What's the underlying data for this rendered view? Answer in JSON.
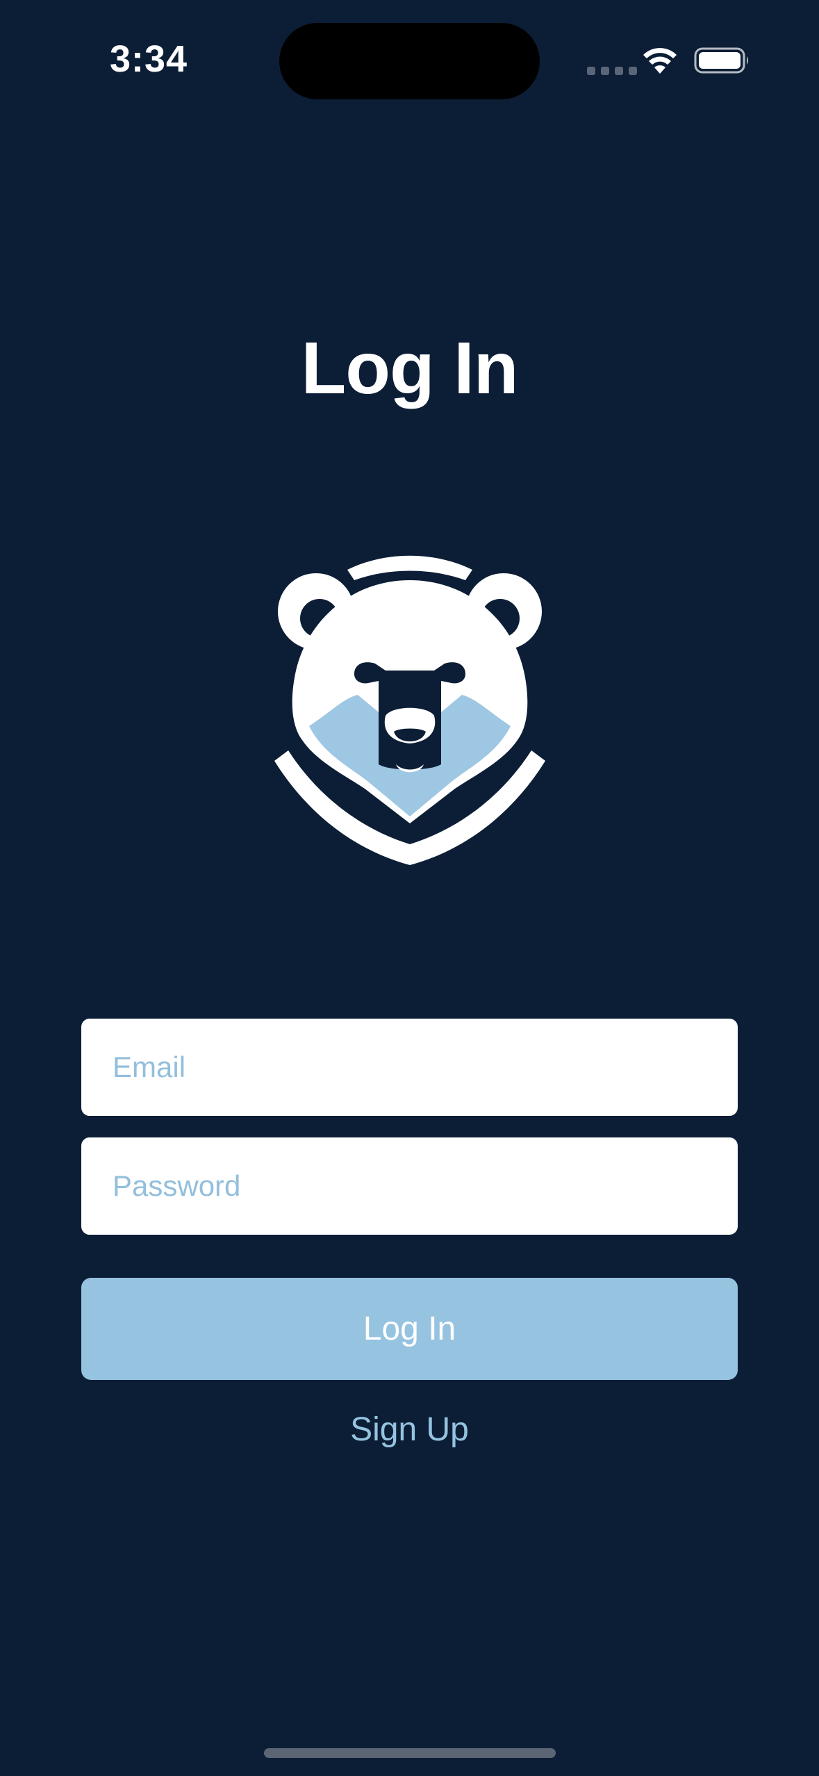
{
  "status_bar": {
    "time": "3:34",
    "wifi_icon": "wifi-icon",
    "battery_icon": "battery-icon"
  },
  "title": "Log In",
  "logo": {
    "icon": "bear-icon",
    "colors": {
      "primary": "#ffffff",
      "accent": "#9ec7e3"
    }
  },
  "form": {
    "email": {
      "placeholder": "Email",
      "value": ""
    },
    "password": {
      "placeholder": "Password",
      "value": ""
    },
    "login_label": "Log In",
    "signup_label": "Sign Up"
  },
  "colors": {
    "background": "#0c1e36",
    "accent": "#95c3e0",
    "field": "#ffffff"
  }
}
